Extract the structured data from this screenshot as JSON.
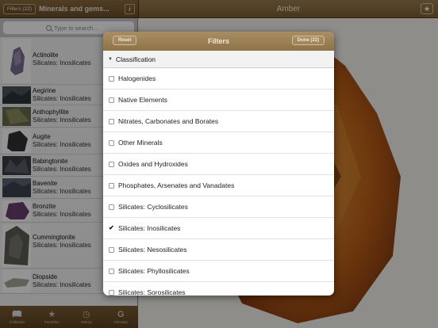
{
  "left_bar": {
    "filters_button": "Filters (22)",
    "title": "Minerals and gems...",
    "info_icon": "i"
  },
  "right_bar": {
    "title": "Amber",
    "star_icon": "★"
  },
  "search": {
    "placeholder": "Type to search..."
  },
  "minerals": [
    {
      "name": "Actinolite",
      "category": "Silicates: Inosilicates",
      "thumb_color": "#7b6d92"
    },
    {
      "name": "Aegirine",
      "category": "Silicates: Inosilicates",
      "thumb_color": "#4a5558"
    },
    {
      "name": "Anthophyllite",
      "category": "Silicates: Inosilicates",
      "thumb_color": "#6a6b4a"
    },
    {
      "name": "Augite",
      "category": "Silicates: Inosilicates",
      "thumb_color": "#2f3135"
    },
    {
      "name": "Babingtonite",
      "category": "Silicates: Inosilicates",
      "thumb_color": "#3a3d42"
    },
    {
      "name": "Bavenite",
      "category": "Silicates: Inosilicates",
      "thumb_color": "#5c6270"
    },
    {
      "name": "Bronzite",
      "category": "Silicates: Inosilicates",
      "thumb_color": "#6a3f6e"
    },
    {
      "name": "Cummingtonite",
      "category": "Silicates: Inosilicates",
      "thumb_color": "#5d5c57"
    },
    {
      "name": "Diopside",
      "category": "Silicates: Inosilicates",
      "thumb_color": "#a7a79b"
    }
  ],
  "tabs": [
    {
      "label": "Collection",
      "icon": "book-icon"
    },
    {
      "label": "Favorites",
      "icon": "star-icon"
    },
    {
      "label": "History",
      "icon": "clock-icon"
    },
    {
      "label": "Glossary",
      "icon": "glossary-icon"
    }
  ],
  "filters": {
    "title": "Filters",
    "reset": "Reset",
    "done": "Done (22)",
    "section": "Classification",
    "options": [
      {
        "label": "Halogenides",
        "checked": false
      },
      {
        "label": "Native Elements",
        "checked": false
      },
      {
        "label": "Nitrates, Carbonates and Borates",
        "checked": false
      },
      {
        "label": "Other Minerals",
        "checked": false
      },
      {
        "label": "Oxides and Hydroxides",
        "checked": false
      },
      {
        "label": "Phosphates, Arsenates and Vanadates",
        "checked": false
      },
      {
        "label": "Silicates: Cyclosilicates",
        "checked": false
      },
      {
        "label": "Silicates: Inosilicates",
        "checked": true
      },
      {
        "label": "Silicates: Nesosilicates",
        "checked": false
      },
      {
        "label": "Silicates: Phyllosilicates",
        "checked": false
      },
      {
        "label": "Silicates: Sorosilicates",
        "checked": false
      }
    ]
  },
  "colors": {
    "brand_brown": "#8e7248",
    "amber": "#c76a1c"
  }
}
